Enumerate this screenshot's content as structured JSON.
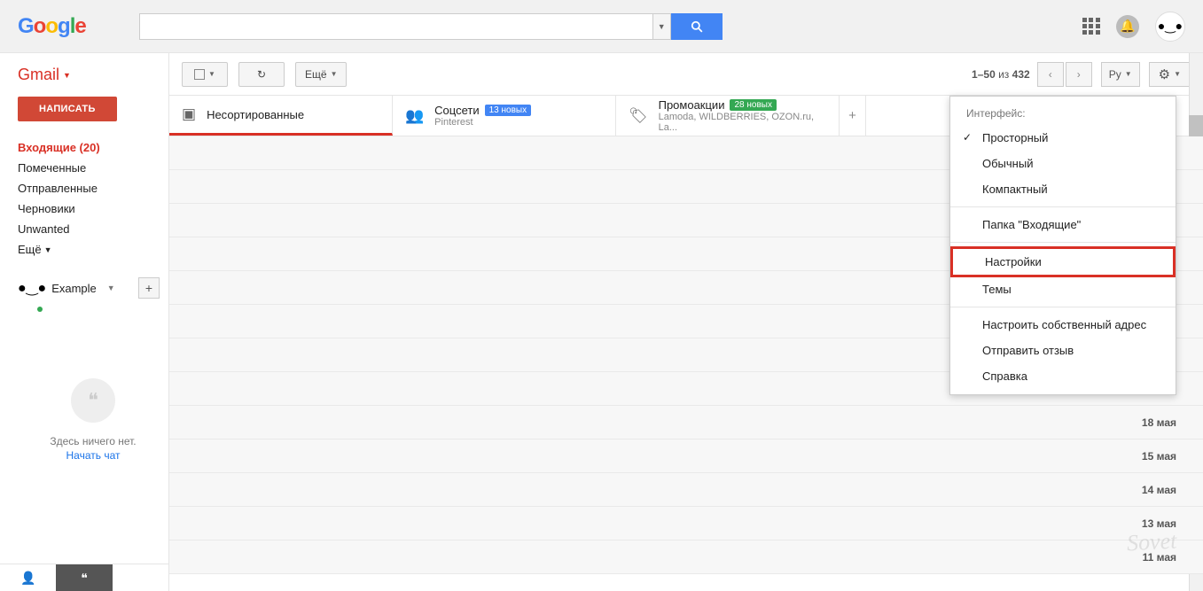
{
  "logo": {
    "chars": [
      "G",
      "o",
      "o",
      "g",
      "l",
      "e"
    ]
  },
  "gmail_label": "Gmail",
  "compose": "НАПИСАТЬ",
  "nav": {
    "inbox": "Входящие (20)",
    "starred": "Помеченные",
    "sent": "Отправленные",
    "drafts": "Черновики",
    "unwanted": "Unwanted",
    "more": "Ещё"
  },
  "chat": {
    "name": "Example",
    "empty_text": "Здесь ничего нет.",
    "start_chat": "Начать чат"
  },
  "toolbar": {
    "more": "Ещё",
    "page_range": "1–50",
    "page_of": "из",
    "page_total": "432",
    "lang": "Ру"
  },
  "tabs": {
    "primary": "Несортированные",
    "social": "Соцсети",
    "social_badge": "13 новых",
    "social_sub": "Pinterest",
    "promo": "Промоакции",
    "promo_badge": "28 новых",
    "promo_sub": "Lamoda, WILDBERRIES, OZON.ru, La..."
  },
  "menu": {
    "header": "Интерфейс:",
    "spacious": "Просторный",
    "normal": "Обычный",
    "compact": "Компактный",
    "inbox_folder": "Папка \"Входящие\"",
    "settings": "Настройки",
    "themes": "Темы",
    "custom_address": "Настроить собственный адрес",
    "feedback": "Отправить отзыв",
    "help": "Справка"
  },
  "dates": [
    "18 мая",
    "15 мая",
    "14 мая",
    "13 мая",
    "11 мая"
  ],
  "watermark": "Sovet"
}
